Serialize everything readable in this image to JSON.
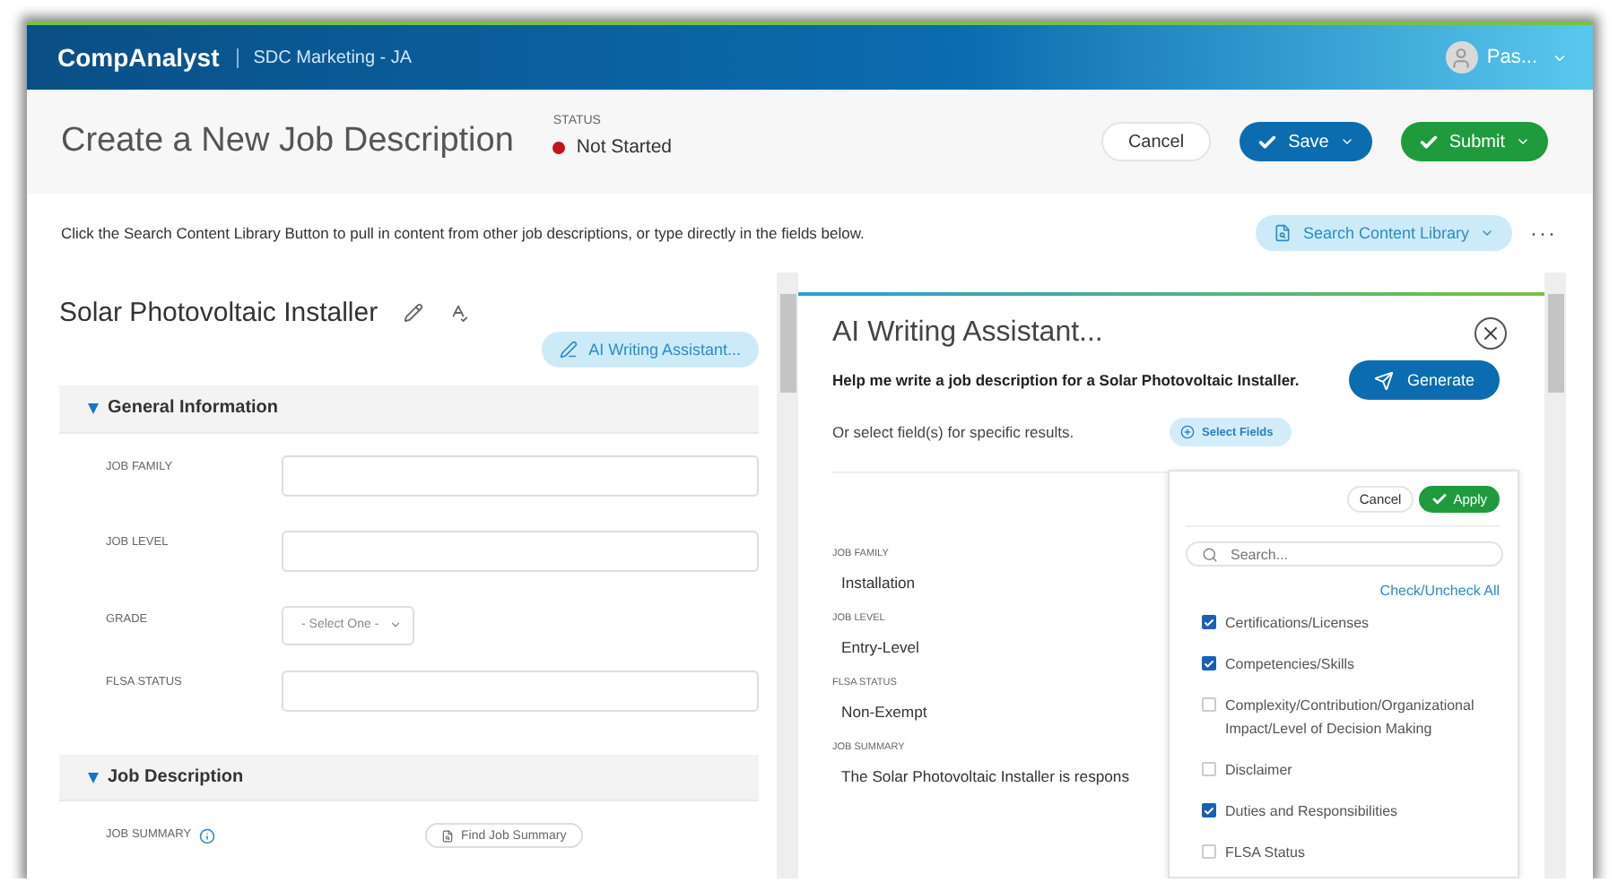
{
  "header": {
    "brand": "CompAnalyst",
    "account": "SDC Marketing - JA",
    "user": "Pas..."
  },
  "page": {
    "title": "Create a New Job Description",
    "status_label": "STATUS",
    "status": "Not Started"
  },
  "actions": [
    {
      "label": "Cancel",
      "kind": "plain"
    },
    {
      "label": "Save",
      "kind": "primary"
    },
    {
      "label": "Submit",
      "kind": "success"
    }
  ],
  "instruction": "Click the Search Content Library Button to pull in content from other job descriptions, or type directly in the fields below.",
  "search_library": "Search Content Library",
  "more": "···",
  "job": {
    "title": "Solar Photovoltaic Installer",
    "ai_button": "AI Writing Assistant..."
  },
  "sections": [
    {
      "title": "General Information",
      "expanded": true,
      "fields": [
        {
          "label": "JOB FAMILY",
          "kind": "text"
        },
        {
          "label": "JOB LEVEL",
          "kind": "text"
        },
        {
          "label": "GRADE",
          "kind": "select",
          "placeholder": "- Select One -"
        },
        {
          "label": "FLSA STATUS",
          "kind": "text"
        }
      ]
    },
    {
      "title": "Job Description",
      "expanded": true,
      "fields": [
        {
          "label": "JOB SUMMARY",
          "kind": "summary",
          "button": "Find Job Summary"
        }
      ]
    }
  ],
  "assistant": {
    "title": "AI Writing Assistant...",
    "prompt": "Help me write a job description for a Solar Photovoltaic Installer.",
    "generate": "Generate",
    "hint": "Or select field(s) for specific results.",
    "select_fields": "Select Fields",
    "results": [
      {
        "label": "JOB FAMILY",
        "value": "Installation"
      },
      {
        "label": "JOB LEVEL",
        "value": "Entry-Level"
      },
      {
        "label": "FLSA STATUS",
        "value": "Non-Exempt"
      },
      {
        "label": "JOB SUMMARY",
        "value": "The Solar Photovoltaic Installer is respons"
      }
    ]
  },
  "field_picker": {
    "cancel": "Cancel",
    "apply": "Apply",
    "search_placeholder": "Search...",
    "toggle_all": "Check/Uncheck All",
    "options": [
      {
        "label": "Certifications/Licenses",
        "checked": true
      },
      {
        "label": "Competencies/Skills",
        "checked": true
      },
      {
        "label": "Complexity/Contribution/Organizational Impact/Level of Decision Making",
        "checked": false
      },
      {
        "label": "Disclaimer",
        "checked": false
      },
      {
        "label": "Duties and Responsibilities",
        "checked": true
      },
      {
        "label": "FLSA Status",
        "checked": false
      }
    ]
  }
}
